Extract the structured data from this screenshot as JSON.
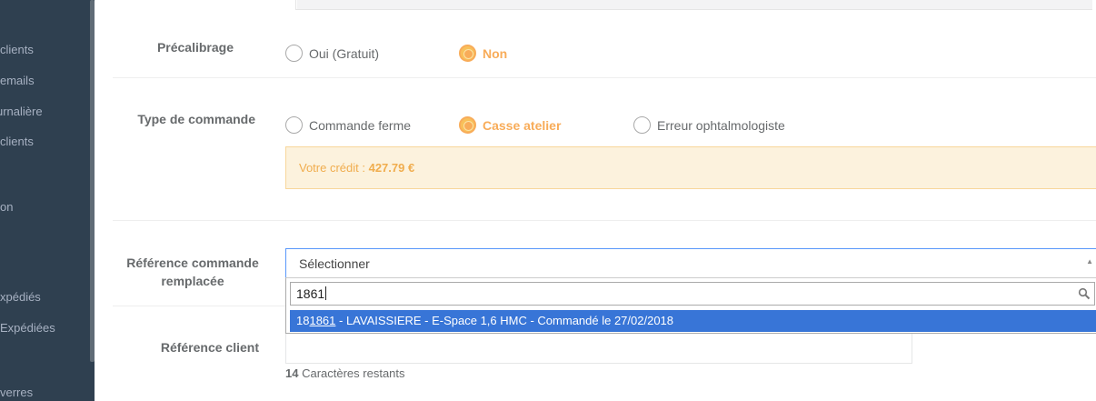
{
  "sidebar": {
    "items": [
      {
        "label": "clients"
      },
      {
        "label": "emails"
      },
      {
        "label": "urnalière"
      },
      {
        "label": " clients"
      },
      {
        "label": "on"
      },
      {
        "label": "xpédiés"
      },
      {
        "label": " Expédiées"
      },
      {
        "label": "verres"
      }
    ]
  },
  "form": {
    "precalibrage": {
      "label": "Précalibrage",
      "options": [
        {
          "label": "Oui (Gratuit)",
          "checked": false
        },
        {
          "label": "Non",
          "checked": true
        }
      ]
    },
    "type_commande": {
      "label": "Type de commande",
      "options": [
        {
          "label": "Commande ferme",
          "checked": false
        },
        {
          "label": "Casse atelier",
          "checked": true
        },
        {
          "label": "Erreur ophtalmologiste",
          "checked": false
        }
      ]
    },
    "credit": {
      "prefix": "Votre crédit : ",
      "amount": "427.79 €"
    },
    "reference_remplacee": {
      "label_line1": "Référence commande",
      "label_line2": "remplacée",
      "selected": "Sélectionner",
      "search_value": "1861",
      "result": {
        "pre": "18",
        "match": "1861",
        "post": " - LAVAISSIERE - E-Space 1,6 HMC - Commandé le 27/02/2018"
      }
    },
    "reference_client": {
      "label": "Référence client",
      "value": "",
      "remaining_count": "14",
      "remaining_text": " Caractères restants"
    }
  },
  "colors": {
    "accent": "#f8ac59",
    "sidebar_bg": "#2f4050",
    "highlight": "#3875d7",
    "alert_bg": "#fcf2dd"
  }
}
